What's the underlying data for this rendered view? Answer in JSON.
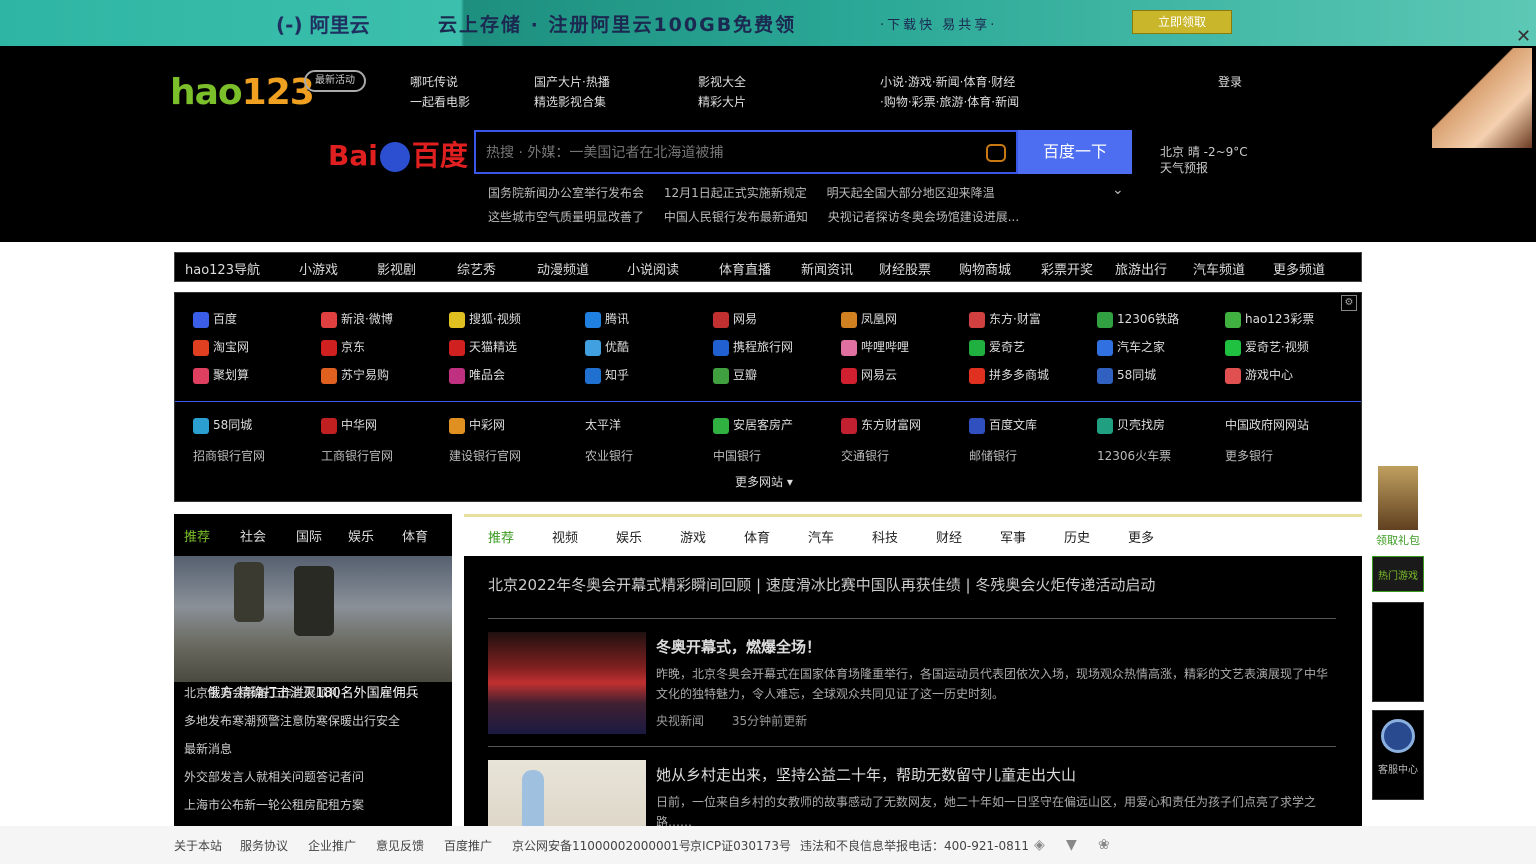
{
  "ad": {
    "logo": "(-) 阿里云",
    "slogan": "云上存储 · 注册阿里云100GB免费领",
    "sub": "·下载快 易共享·",
    "cta": "立即领取",
    "close": "✕"
  },
  "header": {
    "logo_main": "hao",
    "logo_num": "123",
    "logo_badge": "最新活动",
    "col1": [
      "哪吒传说",
      "一起看电影"
    ],
    "col2": [
      "国产大片·热播",
      "精选影视合集"
    ],
    "col3": [
      "影视大全",
      "精彩大片"
    ],
    "col4": [
      "小说·游戏·新闻·体育·财经",
      "·购物·彩票·旅游·体育·新闻"
    ],
    "col5": [
      "登录"
    ],
    "baidu_logo_left": "Bai",
    "baidu_logo_right": "百度",
    "search_placeholder": "热搜 · 外媒：一美国记者在北海道被捕",
    "search_button": "百度一下",
    "weather": [
      "北京  晴  -2~9°C",
      "天气预报"
    ],
    "hot_row1": [
      "国务院新闻办公室举行发布会",
      "12月1日起正式实施新规定",
      "明天起全国大部分地区迎来降温"
    ],
    "hot_row2": [
      "这些城市空气质量明显改善了",
      "中国人民银行发布最新通知",
      "央视记者探访冬奥会场馆建设进展..."
    ]
  },
  "nav": [
    "hao123导航",
    "小游戏",
    "影视剧",
    "综艺秀",
    "动漫频道",
    "小说阅读",
    "体育直播",
    "新闻资讯",
    "财经股票",
    "购物商城",
    "彩票开奖",
    "旅游出行",
    "汽车频道",
    "更多频道"
  ],
  "sites_row1": [
    "百度",
    "新浪·微博",
    "搜狐·视频",
    "腾讯",
    "网易",
    "凤凰网",
    "东方·财富",
    "12306铁路",
    "hao123彩票"
  ],
  "sites_row2": [
    "淘宝网",
    "京东",
    "天猫精选",
    "优酷",
    "携程旅行网",
    "哔哩哔哩",
    "爱奇艺",
    "汽车之家",
    "爱奇艺·视频"
  ],
  "sites_row3": [
    "聚划算",
    "苏宁易购",
    "唯品会",
    "知乎",
    "豆瓣",
    "网易云",
    "拼多多商城",
    "58同城",
    "游戏中心"
  ],
  "sites_row4": [
    "58同城",
    "中华网",
    "中彩网",
    "太平洋",
    "安居客房产",
    "东方财富网",
    "百度文库",
    "贝壳找房",
    "中国政府网网站"
  ],
  "sites_row5": [
    "招商银行官网",
    "工商银行官网",
    "建设银行官网",
    "农业银行",
    "中国银行",
    "交通银行",
    "邮储银行",
    "12306火车票",
    "更多银行"
  ],
  "more_sites": "更多网站 ▾",
  "left_tabs": [
    "推荐",
    "社会",
    "国际",
    "娱乐",
    "体育"
  ],
  "hero_caption": "俄方:精确打击消灭180名外国雇佣兵",
  "left_news": [
    "北京冬奥会筹备工作进展顺利",
    "多地发布寒潮预警注意防寒保暖出行安全",
    "最新消息",
    "外交部发言人就相关问题答记者问",
    "上海市公布新一轮公租房配租方案"
  ],
  "main_tabs": [
    "推荐",
    "视频",
    "娱乐",
    "游戏",
    "体育",
    "汽车",
    "科技",
    "财经",
    "军事",
    "历史",
    "更多"
  ],
  "headline": "北京2022年冬奥会开幕式精彩瞬间回顾  |  速度滑冰比赛中国队再获佳绩  |  冬残奥会火炬传递活动启动",
  "news1": {
    "title": "冬奥开幕式，燃爆全场！",
    "desc": "昨晚，北京冬奥会开幕式在国家体育场隆重举行，各国运动员代表团依次入场，现场观众热情高涨，精彩的文艺表演展现了中华文化的独特魅力，令人难忘，全球观众共同见证了这一历史时刻。",
    "meta_source": "央视新闻",
    "meta_time": "35分钟前更新"
  },
  "news2": {
    "title": "她从乡村走出来，坚持公益二十年，帮助无数留守儿童走出大山",
    "desc": "日前，一位来自乡村的女教师的故事感动了无数网友，她二十年如一日坚守在偏远山区，用爱心和责任为孩子们点亮了求学之路……"
  },
  "right_float": [
    "领取礼包",
    "热门游戏",
    "客服中心"
  ],
  "footer": [
    "关于本站",
    "服务协议",
    "企业推广",
    "意见反馈",
    "百度推广",
    "京公网安备11000002000001号",
    "京ICP证030173号",
    "违法和不良信息举报电话：400-921-0811"
  ]
}
